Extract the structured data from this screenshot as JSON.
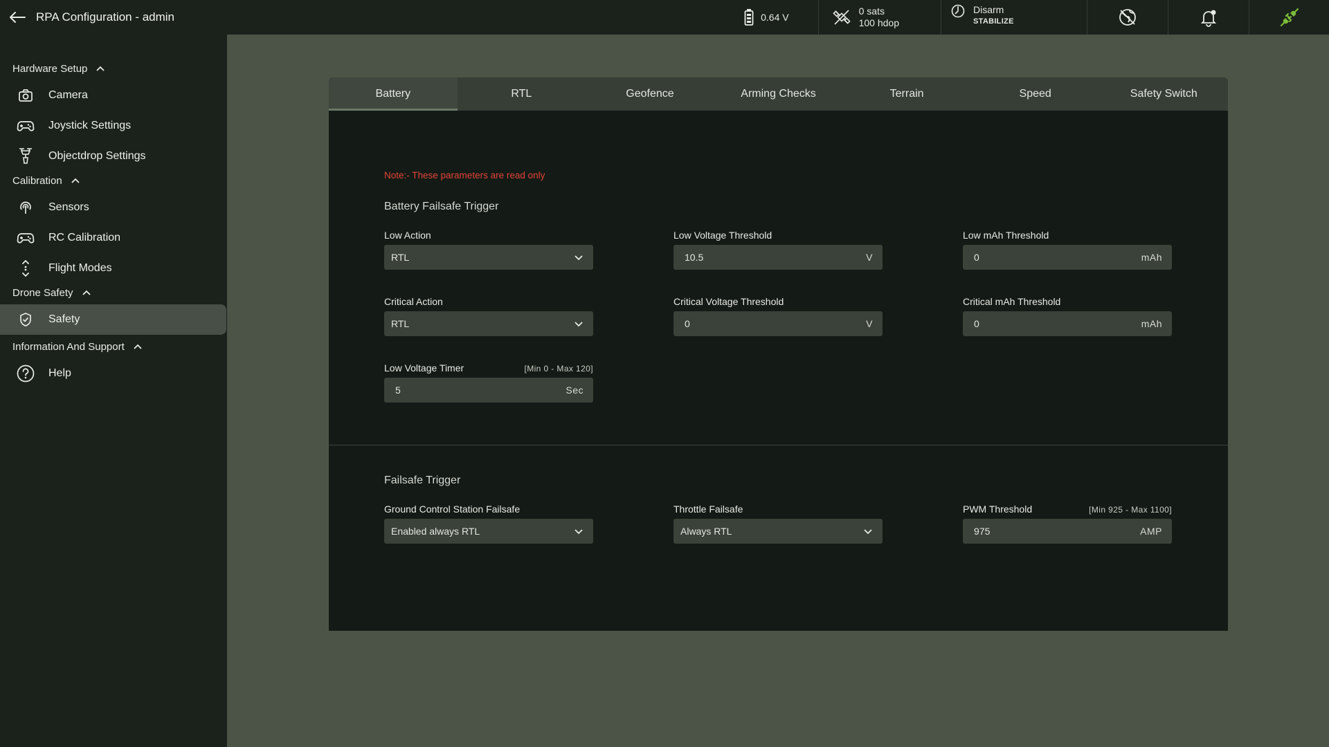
{
  "header": {
    "title": "RPA Configuration - admin",
    "battery_voltage": "0.64 V",
    "gps_sats": "0 sats",
    "gps_hdop": "100 hdop",
    "arm_state": "Disarm",
    "flight_mode": "STABILIZE"
  },
  "sidebar": {
    "groups": [
      {
        "label": "Hardware Setup",
        "items": [
          {
            "label": "Camera"
          },
          {
            "label": "Joystick Settings"
          },
          {
            "label": "Objectdrop Settings"
          }
        ]
      },
      {
        "label": "Calibration",
        "items": [
          {
            "label": "Sensors"
          },
          {
            "label": "RC Calibration"
          },
          {
            "label": "Flight Modes"
          }
        ]
      },
      {
        "label": "Drone Safety",
        "items": [
          {
            "label": "Safety"
          }
        ]
      },
      {
        "label": "Information And Support",
        "items": [
          {
            "label": "Help"
          }
        ]
      }
    ]
  },
  "tabs": [
    "Battery",
    "RTL",
    "Geofence",
    "Arming Checks",
    "Terrain",
    "Speed",
    "Safety Switch"
  ],
  "note": "Note:- These parameters are read only",
  "battery_section": {
    "title": "Battery Failsafe Trigger",
    "low_action": {
      "label": "Low Action",
      "value": "RTL"
    },
    "low_voltage_threshold": {
      "label": "Low Voltage Threshold",
      "value": "10.5",
      "unit": "V"
    },
    "low_mah_threshold": {
      "label": "Low mAh Threshold",
      "value": "0",
      "unit": "mAh"
    },
    "critical_action": {
      "label": "Critical Action",
      "value": "RTL"
    },
    "critical_voltage_threshold": {
      "label": "Critical Voltage Threshold",
      "value": "0",
      "unit": "V"
    },
    "critical_mah_threshold": {
      "label": "Critical mAh Threshold",
      "value": "0",
      "unit": "mAh"
    },
    "low_voltage_timer": {
      "label": "Low Voltage Timer",
      "range": "[Min 0 - Max 120]",
      "value": "5",
      "unit": "Sec"
    }
  },
  "failsafe_section": {
    "title": "Failsafe Trigger",
    "gcs_failsafe": {
      "label": "Ground Control Station Failsafe",
      "value": "Enabled always RTL"
    },
    "throttle_failsafe": {
      "label": "Throttle Failsafe",
      "value": "Always RTL"
    },
    "pwm_threshold": {
      "label": "PWM Threshold",
      "range": "[Min 925 - Max 1100]",
      "value": "975",
      "unit": "AMP"
    }
  },
  "colors": {
    "accent_green": "#7dbb3a",
    "note_red": "#e0453a",
    "active_tab": "#3f473f",
    "sidebar_bg": "#1b221c",
    "page_bg": "#4b5447"
  }
}
